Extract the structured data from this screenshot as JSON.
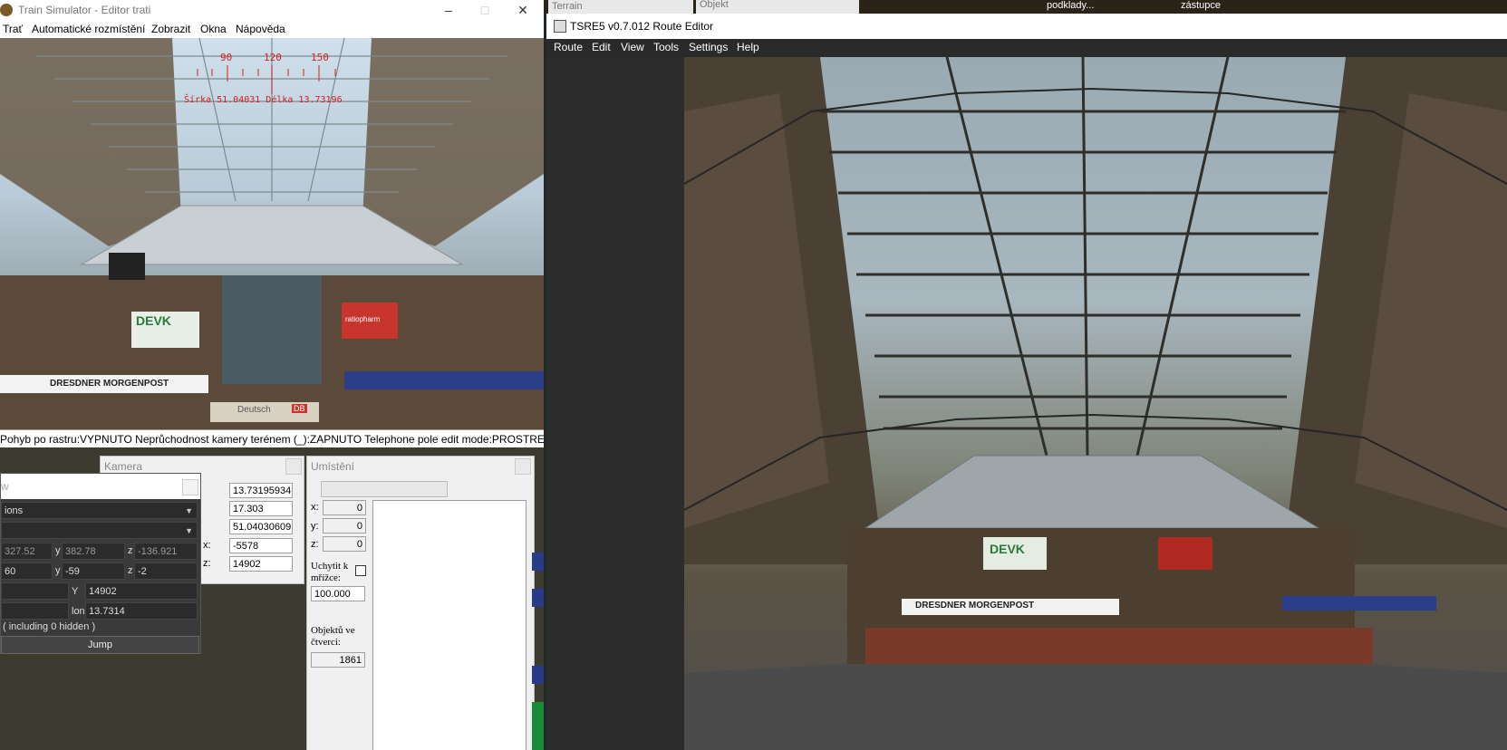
{
  "left_window": {
    "title": "Train Simulator - Editor trati",
    "menu": [
      "Trať",
      "Automatické rozmístění",
      "Zobrazit",
      "Okna",
      "Nápověda"
    ],
    "compass": {
      "ticks": [
        "90",
        "120",
        "150"
      ],
      "readout": "Šírka 51.04031 Délka 13.73196"
    },
    "scene_signs": [
      "DEVK",
      "ratiopharm",
      "DRESDNER MORGENPOST",
      "Deutsch",
      "DB"
    ],
    "status_bar": "Pohyb po rastru:VYPNUTO Neprůchodnost kamery terénem (_):ZAPNUTO Telephone pole edit mode:PROSTREDNÍ"
  },
  "camera_panel": {
    "title": "Kamera",
    "values": [
      "13.73195934",
      "17.303",
      "51.04030609",
      "-5578",
      "14902"
    ],
    "labels": {
      "x": "x:",
      "z": "z:"
    }
  },
  "umisteni_panel": {
    "title": "Umístění",
    "x_label": "x:",
    "x": "0",
    "y_label": "y:",
    "y": "0",
    "z_label": "z:",
    "z": "0",
    "snap_label": "Uchytit k mřížce:",
    "grid_value": "100.000",
    "objects_label": "Objektů ve čtverci:",
    "objects_count": "1861"
  },
  "nav_panel": {
    "title": "w",
    "dropdown1": "ions",
    "row1": {
      "x": "327.52",
      "y_label": "y",
      "y": "382.78",
      "z_label": "z",
      "z": "-136.921"
    },
    "row2": {
      "x": "60",
      "y_label": "y",
      "y": "-59",
      "z_label": "z",
      "z": "-2"
    },
    "Y_label": "Y",
    "Y": "14902",
    "lon_label": "lon",
    "lon": "13.7314",
    "hidden_text": "( including 0 hidden )",
    "jump_label": "Jump"
  },
  "background_tabs": {
    "terrain": "Terrain",
    "objekt": "Objekt",
    "podklady": "podklady...",
    "zastupce": "zástupce"
  },
  "right_window": {
    "title": "TSRE5 v0.7.012 Route Editor",
    "menu": [
      "Route",
      "Edit",
      "View",
      "Tools",
      "Settings",
      "Help"
    ],
    "scene_signs": [
      "DEVK",
      "DRESDNER MORGENPOST"
    ]
  },
  "colors": {
    "compass_red": "#d22020",
    "menu_dark": "#2a2a2a",
    "status_black": "#000000"
  }
}
